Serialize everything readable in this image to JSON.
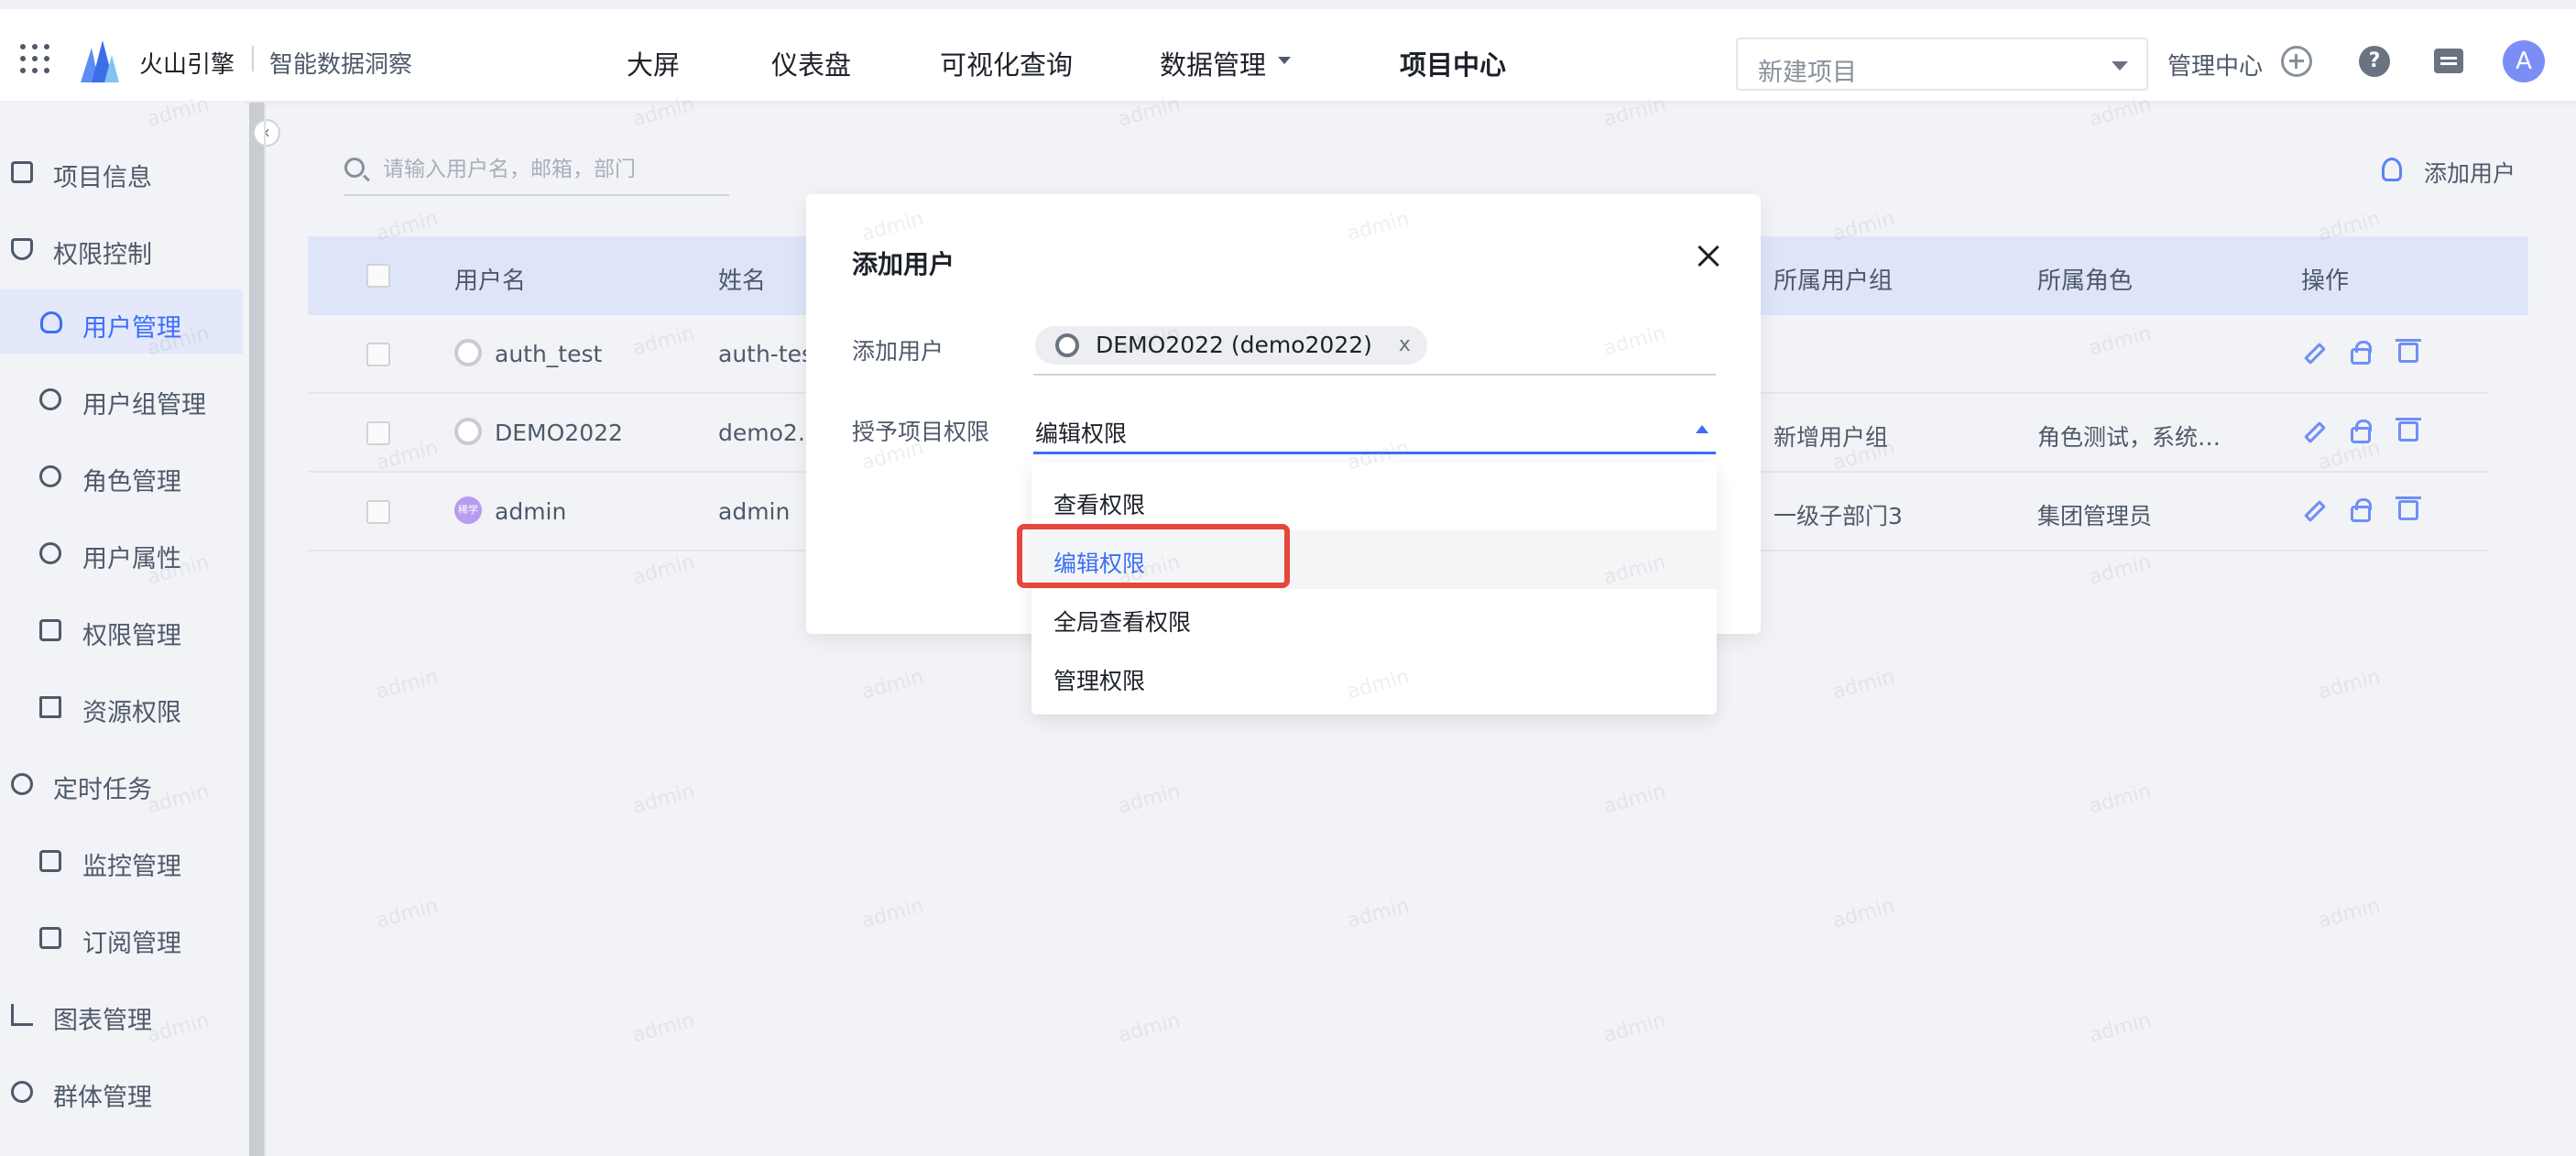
{
  "topbar": {
    "brand": "火山引擎",
    "product": "智能数据洞察",
    "nav": [
      {
        "label": "大屏"
      },
      {
        "label": "仪表盘"
      },
      {
        "label": "可视化查询"
      },
      {
        "label": "数据管理"
      },
      {
        "label": "项目中心"
      }
    ],
    "project_select_placeholder": "新建项目",
    "admin_center": "管理中心",
    "help_glyph": "?",
    "avatar_initial": "A"
  },
  "sidebar": {
    "items": [
      {
        "label": "项目信息",
        "icon": "list-icon"
      },
      {
        "label": "权限控制",
        "icon": "shield-icon"
      },
      {
        "label": "用户管理",
        "icon": "user-icon",
        "active": true
      },
      {
        "label": "用户组管理",
        "icon": "users-icon"
      },
      {
        "label": "角色管理",
        "icon": "role-icon"
      },
      {
        "label": "用户属性",
        "icon": "user-attr-icon"
      },
      {
        "label": "权限管理",
        "icon": "lock-icon"
      },
      {
        "label": "资源权限",
        "icon": "resource-icon"
      },
      {
        "label": "定时任务",
        "icon": "clock-icon"
      },
      {
        "label": "监控管理",
        "icon": "monitor-icon"
      },
      {
        "label": "订阅管理",
        "icon": "bookmark-icon"
      },
      {
        "label": "图表管理",
        "icon": "bar-chart-icon"
      },
      {
        "label": "群体管理",
        "icon": "group-icon"
      }
    ],
    "collapse_glyph": "‹"
  },
  "main": {
    "search_placeholder": "请输入用户名，邮箱，部门",
    "add_user_label": "添加用户",
    "columns": [
      "用户名",
      "姓名",
      "所属用户组",
      "所属角色",
      "操作"
    ],
    "rows": [
      {
        "username": "auth_test",
        "name": "auth-test",
        "group": "",
        "role": ""
      },
      {
        "username": "DEMO2022",
        "name": "demo2…",
        "group": "新增用户组",
        "role": "角色测试，系统…"
      },
      {
        "username": "admin",
        "name": "admin",
        "group": "一级子部门3",
        "role": "集团管理员",
        "avatar_text": "稀学"
      }
    ]
  },
  "modal": {
    "title": "添加用户",
    "add_user_label": "添加用户",
    "selected_user_tag": "DEMO2022 (demo2022)",
    "tag_remove_glyph": "x",
    "permission_label": "授予项目权限",
    "permission_value": "编辑权限",
    "options": [
      "查看权限",
      "编辑权限",
      "全局查看权限",
      "管理权限"
    ],
    "selected_option_index": 1
  },
  "watermark_text": "admin",
  "colors": {
    "accent": "#3b6ff5",
    "highlight_border": "#e8453c",
    "table_header_bg": "#dfe5f9"
  }
}
